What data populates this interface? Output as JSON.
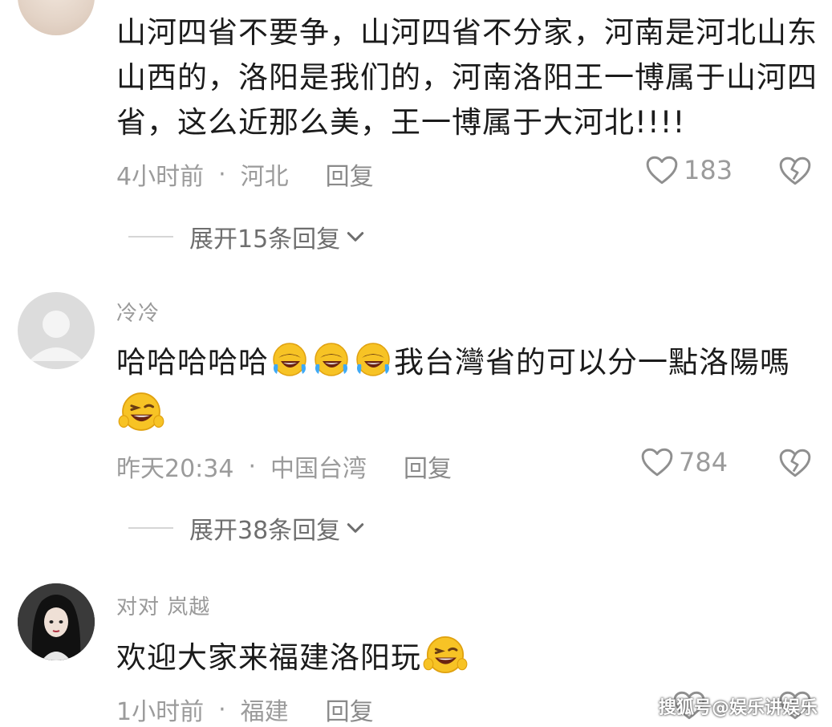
{
  "comments": [
    {
      "text_lines": [
        "山河四省不要争，山河四省不分家，河南是河北山东",
        "山西的，洛阳是我们的，河南洛阳王一博属于山河四",
        "省，这么近那么美，王一博属于大河北!!!!"
      ],
      "time": "4小时前",
      "location": "河北",
      "reply_label": "回复",
      "likes": "183",
      "expand_label": "展开15条回复"
    },
    {
      "username": "冷冷",
      "text": "哈哈哈哈哈",
      "text_tail": "我台灣省的可以分一點洛陽嗎",
      "time": "昨天20:34",
      "location": "中国台湾",
      "reply_label": "回复",
      "likes": "784",
      "expand_label": "展开38条回复"
    },
    {
      "username": "对对 岚越",
      "text": "欢迎大家来福建洛阳玩",
      "time": "1小时前",
      "location": "福建",
      "reply_label": "回复"
    }
  ],
  "watermark": "搜狐号@娱乐讲娱乐",
  "icons": {
    "like": "heart-outline-icon",
    "dislike": "broken-heart-icon",
    "expand": "chevron-down-icon",
    "emoji_laugh": "rofl-emoji",
    "emoji_wink": "wink-grin-emoji"
  }
}
